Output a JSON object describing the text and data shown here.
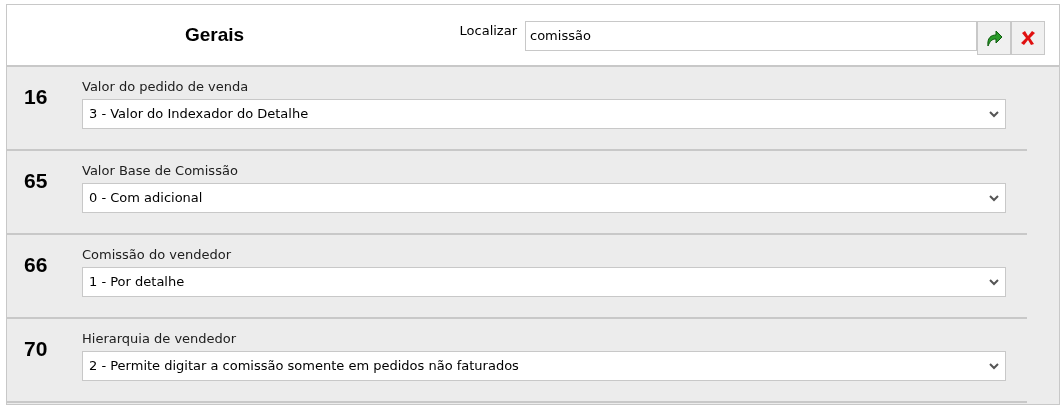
{
  "header": {
    "title": "Gerais",
    "search": {
      "label": "Localizar",
      "value": "comissão"
    }
  },
  "parameters": [
    {
      "number": "16",
      "label": "Valor do pedido de venda",
      "value": "3 - Valor do Indexador do Detalhe"
    },
    {
      "number": "65",
      "label": "Valor Base de Comissão",
      "value": "0 - Com adicional"
    },
    {
      "number": "66",
      "label": "Comissão do vendedor",
      "value": "1 - Por detalhe"
    },
    {
      "number": "70",
      "label": "Hierarquia de vendedor",
      "value": "2 - Permite digitar a comissão somente em pedidos não faturados"
    }
  ]
}
